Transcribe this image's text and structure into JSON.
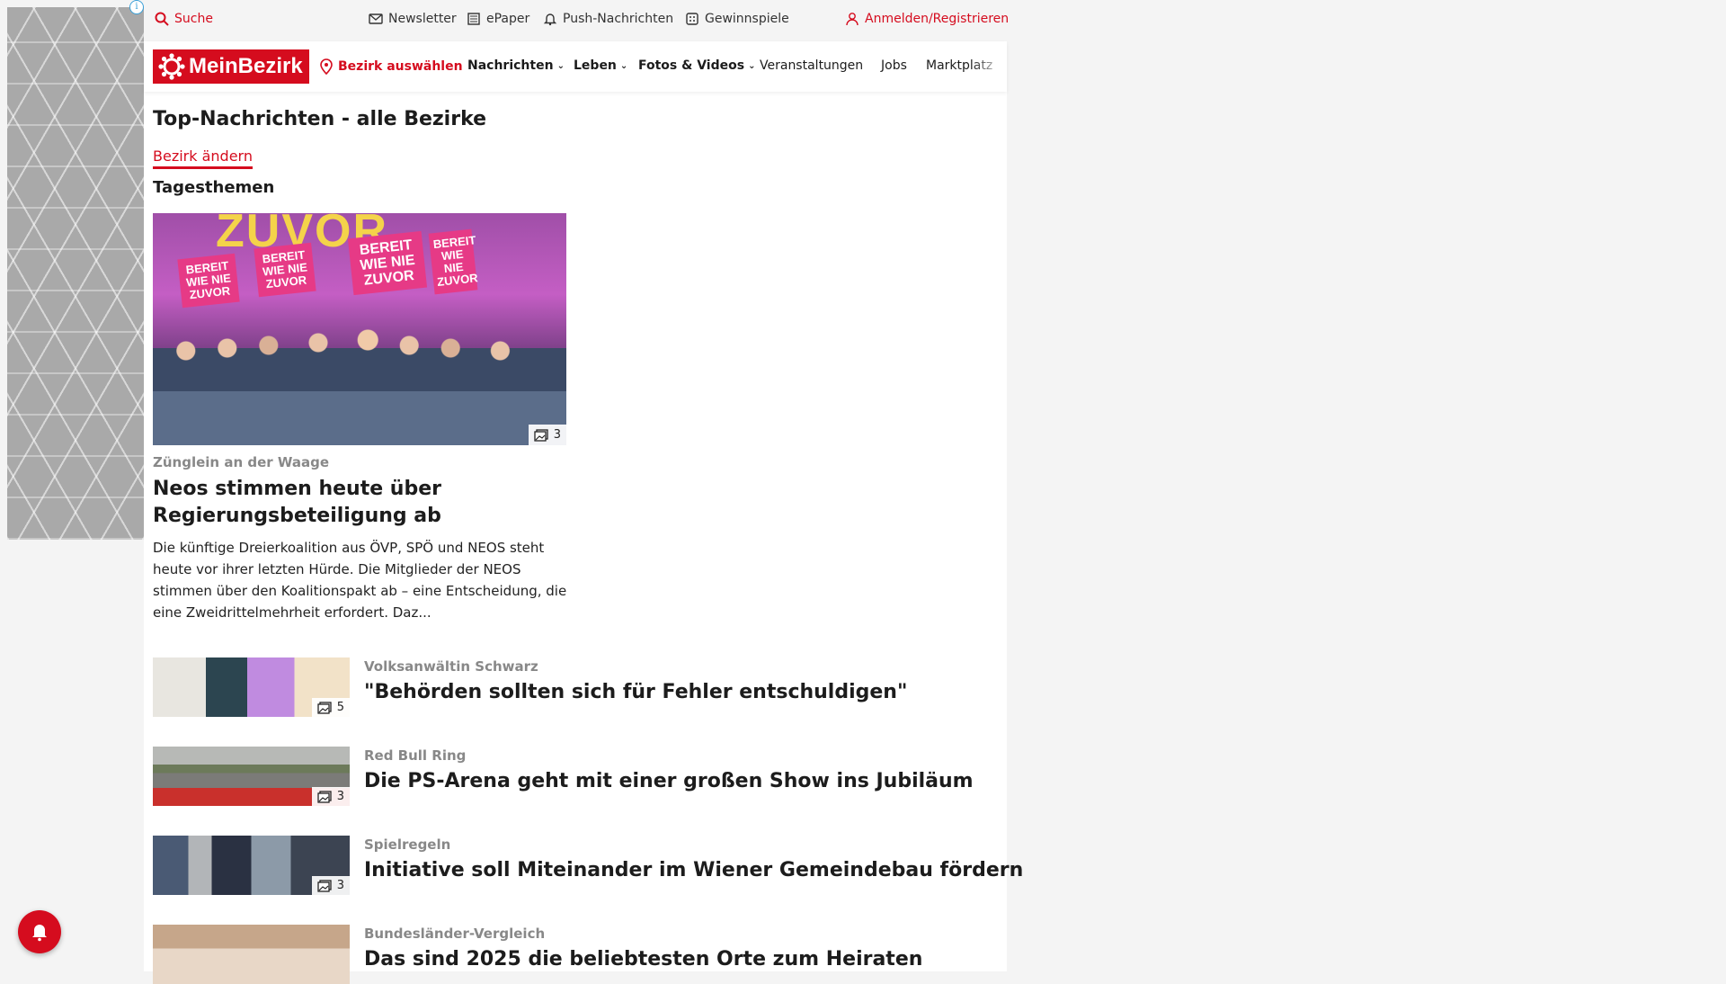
{
  "utility": {
    "search": "Suche",
    "newsletter": "Newsletter",
    "epaper": "ePaper",
    "push": "Push-Nachrichten",
    "gewinnspiele": "Gewinnspiele",
    "login": "Anmelden/Registrieren"
  },
  "nav": {
    "logo": "MeinBezirk",
    "bezirk_select": "Bezirk auswählen",
    "items": [
      "Nachrichten",
      "Leben",
      "Fotos & Videos",
      "Veranstaltungen",
      "Jobs",
      "Marktplatz"
    ]
  },
  "main": {
    "title": "Top-Nachrichten - alle Bezirke",
    "change_link": "Bezirk ändern",
    "section": "Tagesthemen",
    "feature": {
      "banner_text": "ZUVOR",
      "sign_text": "BEREIT WIE NIE ZUVOR",
      "gallery_count": "3",
      "kicker": "Zünglein an der Waage",
      "headline": "Neos stimmen heute über Regierungsbeteiligung ab",
      "teaser": "Die künftige Dreierkoalition aus ÖVP, SPÖ und NEOS steht heute vor ihrer letzten Hürde. Die Mitglieder der NEOS stimmen über den Koalitionspakt ab – eine Entscheidung, die eine Zweidrittelmehrheit erfordert. Daz..."
    },
    "articles": [
      {
        "kicker": "Volksanwältin Schwarz",
        "headline": "\"Behörden sollten sich für Fehler entschuldigen\"",
        "gallery_count": "5"
      },
      {
        "kicker": "Red Bull Ring",
        "headline": "Die PS-Arena geht mit einer großen Show ins Jubiläum",
        "gallery_count": "3"
      },
      {
        "kicker": "Spielregeln",
        "headline": "Initiative soll Miteinander im Wiener Gemeindebau fördern",
        "gallery_count": "3"
      },
      {
        "kicker": "Bundesländer-Vergleich",
        "headline": "Das sind 2025 die beliebtesten Orte zum Heiraten",
        "gallery_count": ""
      }
    ]
  },
  "ad": {
    "info": "i"
  },
  "colors": {
    "brand": "#d50c1e",
    "kicker": "#888888"
  }
}
